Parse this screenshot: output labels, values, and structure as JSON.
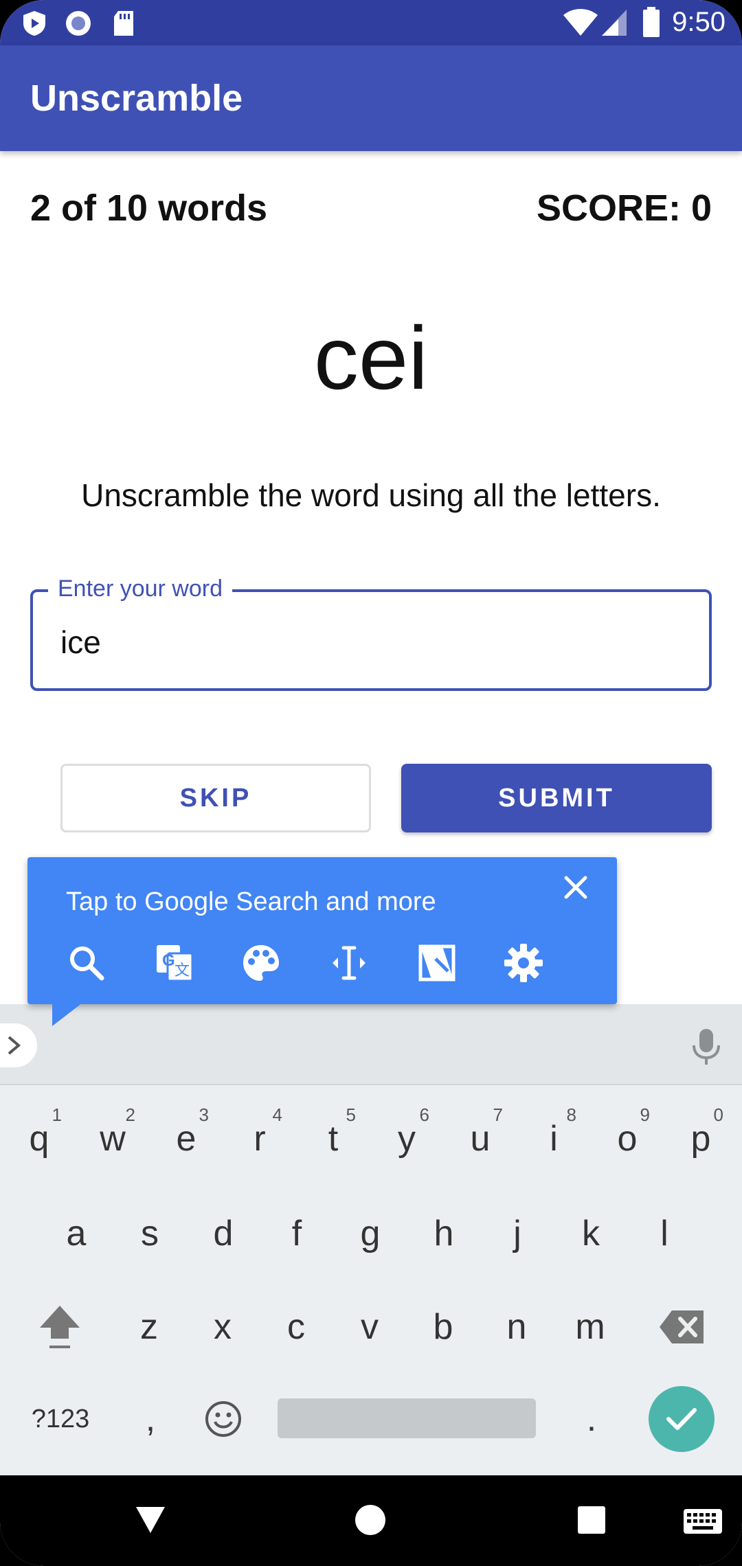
{
  "status_bar": {
    "time": "9:50"
  },
  "app_bar": {
    "title": "Unscramble"
  },
  "game": {
    "word_count": "2 of 10 words",
    "score": "SCORE: 0",
    "scrambled_word": "cei",
    "instructions": "Unscramble the word using all the letters."
  },
  "input": {
    "label": "Enter your word",
    "value": "ice"
  },
  "buttons": {
    "skip": "SKIP",
    "submit": "SUBMIT"
  },
  "google_tip": {
    "text": "Tap to Google Search and more",
    "tools": [
      "search-icon",
      "translate-icon",
      "palette-icon",
      "text-select-icon",
      "screenshot-icon",
      "settings-icon"
    ]
  },
  "keyboard": {
    "row1": [
      "q",
      "w",
      "e",
      "r",
      "t",
      "y",
      "u",
      "i",
      "o",
      "p"
    ],
    "row1_hints": [
      "1",
      "2",
      "3",
      "4",
      "5",
      "6",
      "7",
      "8",
      "9",
      "0"
    ],
    "row2": [
      "a",
      "s",
      "d",
      "f",
      "g",
      "h",
      "j",
      "k",
      "l"
    ],
    "row3": [
      "z",
      "x",
      "c",
      "v",
      "b",
      "n",
      "m"
    ],
    "symbols_key": "?123",
    "comma_key": ",",
    "period_key": "."
  },
  "colors": {
    "primary": "#3f51b5",
    "primary_dark": "#303f9f",
    "tooltip": "#4285f4",
    "enter": "#4db6ac"
  }
}
